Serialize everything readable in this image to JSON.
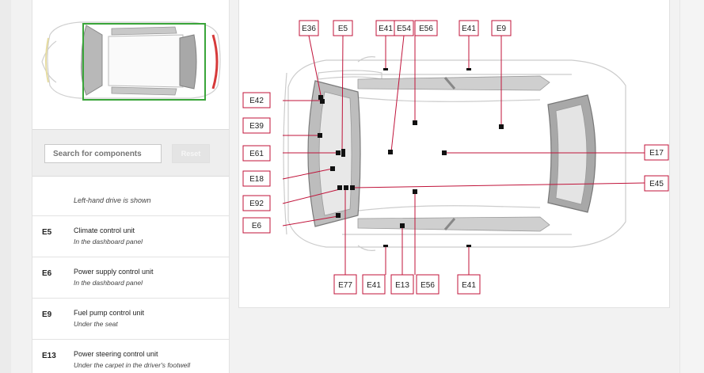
{
  "search": {
    "placeholder": "Search for components",
    "reset_label": "Reset"
  },
  "note": "Left-hand drive is shown",
  "components": [
    {
      "code": "E5",
      "name": "Climate control unit",
      "location": "In the dashboard panel"
    },
    {
      "code": "E6",
      "name": "Power supply control unit",
      "location": "In the dashboard panel"
    },
    {
      "code": "E9",
      "name": "Fuel pump control unit",
      "location": "Under the seat"
    },
    {
      "code": "E13",
      "name": "Power steering control unit",
      "location": "Under the carpet in the driver's footwell"
    }
  ],
  "diagram_labels": {
    "top": [
      "E36",
      "E5",
      "E41",
      "E54",
      "E56",
      "E41",
      "E9"
    ],
    "left": [
      "E42",
      "E39",
      "E61",
      "E18",
      "E92",
      "E6"
    ],
    "right": [
      "E17",
      "E45"
    ],
    "bottom": [
      "E77",
      "E41",
      "E13",
      "E56",
      "E41"
    ]
  },
  "colors": {
    "accent": "#c0133a",
    "selection": "#3aa53a",
    "marker": "#111111"
  }
}
